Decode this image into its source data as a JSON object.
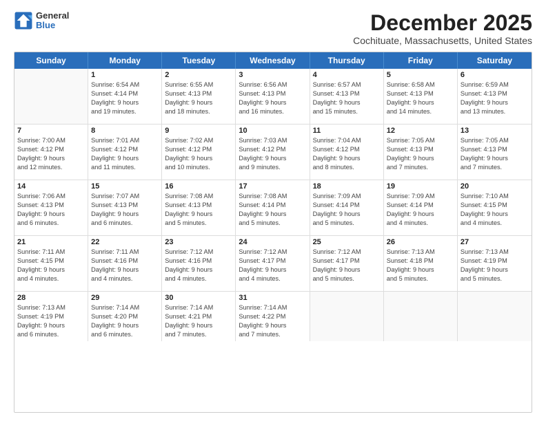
{
  "logo": {
    "general": "General",
    "blue": "Blue"
  },
  "title": "December 2025",
  "subtitle": "Cochituate, Massachusetts, United States",
  "header_days": [
    "Sunday",
    "Monday",
    "Tuesday",
    "Wednesday",
    "Thursday",
    "Friday",
    "Saturday"
  ],
  "weeks": [
    [
      {
        "day": "",
        "lines": []
      },
      {
        "day": "1",
        "lines": [
          "Sunrise: 6:54 AM",
          "Sunset: 4:14 PM",
          "Daylight: 9 hours",
          "and 19 minutes."
        ]
      },
      {
        "day": "2",
        "lines": [
          "Sunrise: 6:55 AM",
          "Sunset: 4:13 PM",
          "Daylight: 9 hours",
          "and 18 minutes."
        ]
      },
      {
        "day": "3",
        "lines": [
          "Sunrise: 6:56 AM",
          "Sunset: 4:13 PM",
          "Daylight: 9 hours",
          "and 16 minutes."
        ]
      },
      {
        "day": "4",
        "lines": [
          "Sunrise: 6:57 AM",
          "Sunset: 4:13 PM",
          "Daylight: 9 hours",
          "and 15 minutes."
        ]
      },
      {
        "day": "5",
        "lines": [
          "Sunrise: 6:58 AM",
          "Sunset: 4:13 PM",
          "Daylight: 9 hours",
          "and 14 minutes."
        ]
      },
      {
        "day": "6",
        "lines": [
          "Sunrise: 6:59 AM",
          "Sunset: 4:13 PM",
          "Daylight: 9 hours",
          "and 13 minutes."
        ]
      }
    ],
    [
      {
        "day": "7",
        "lines": [
          "Sunrise: 7:00 AM",
          "Sunset: 4:12 PM",
          "Daylight: 9 hours",
          "and 12 minutes."
        ]
      },
      {
        "day": "8",
        "lines": [
          "Sunrise: 7:01 AM",
          "Sunset: 4:12 PM",
          "Daylight: 9 hours",
          "and 11 minutes."
        ]
      },
      {
        "day": "9",
        "lines": [
          "Sunrise: 7:02 AM",
          "Sunset: 4:12 PM",
          "Daylight: 9 hours",
          "and 10 minutes."
        ]
      },
      {
        "day": "10",
        "lines": [
          "Sunrise: 7:03 AM",
          "Sunset: 4:12 PM",
          "Daylight: 9 hours",
          "and 9 minutes."
        ]
      },
      {
        "day": "11",
        "lines": [
          "Sunrise: 7:04 AM",
          "Sunset: 4:12 PM",
          "Daylight: 9 hours",
          "and 8 minutes."
        ]
      },
      {
        "day": "12",
        "lines": [
          "Sunrise: 7:05 AM",
          "Sunset: 4:13 PM",
          "Daylight: 9 hours",
          "and 7 minutes."
        ]
      },
      {
        "day": "13",
        "lines": [
          "Sunrise: 7:05 AM",
          "Sunset: 4:13 PM",
          "Daylight: 9 hours",
          "and 7 minutes."
        ]
      }
    ],
    [
      {
        "day": "14",
        "lines": [
          "Sunrise: 7:06 AM",
          "Sunset: 4:13 PM",
          "Daylight: 9 hours",
          "and 6 minutes."
        ]
      },
      {
        "day": "15",
        "lines": [
          "Sunrise: 7:07 AM",
          "Sunset: 4:13 PM",
          "Daylight: 9 hours",
          "and 6 minutes."
        ]
      },
      {
        "day": "16",
        "lines": [
          "Sunrise: 7:08 AM",
          "Sunset: 4:13 PM",
          "Daylight: 9 hours",
          "and 5 minutes."
        ]
      },
      {
        "day": "17",
        "lines": [
          "Sunrise: 7:08 AM",
          "Sunset: 4:14 PM",
          "Daylight: 9 hours",
          "and 5 minutes."
        ]
      },
      {
        "day": "18",
        "lines": [
          "Sunrise: 7:09 AM",
          "Sunset: 4:14 PM",
          "Daylight: 9 hours",
          "and 5 minutes."
        ]
      },
      {
        "day": "19",
        "lines": [
          "Sunrise: 7:09 AM",
          "Sunset: 4:14 PM",
          "Daylight: 9 hours",
          "and 4 minutes."
        ]
      },
      {
        "day": "20",
        "lines": [
          "Sunrise: 7:10 AM",
          "Sunset: 4:15 PM",
          "Daylight: 9 hours",
          "and 4 minutes."
        ]
      }
    ],
    [
      {
        "day": "21",
        "lines": [
          "Sunrise: 7:11 AM",
          "Sunset: 4:15 PM",
          "Daylight: 9 hours",
          "and 4 minutes."
        ]
      },
      {
        "day": "22",
        "lines": [
          "Sunrise: 7:11 AM",
          "Sunset: 4:16 PM",
          "Daylight: 9 hours",
          "and 4 minutes."
        ]
      },
      {
        "day": "23",
        "lines": [
          "Sunrise: 7:12 AM",
          "Sunset: 4:16 PM",
          "Daylight: 9 hours",
          "and 4 minutes."
        ]
      },
      {
        "day": "24",
        "lines": [
          "Sunrise: 7:12 AM",
          "Sunset: 4:17 PM",
          "Daylight: 9 hours",
          "and 4 minutes."
        ]
      },
      {
        "day": "25",
        "lines": [
          "Sunrise: 7:12 AM",
          "Sunset: 4:17 PM",
          "Daylight: 9 hours",
          "and 5 minutes."
        ]
      },
      {
        "day": "26",
        "lines": [
          "Sunrise: 7:13 AM",
          "Sunset: 4:18 PM",
          "Daylight: 9 hours",
          "and 5 minutes."
        ]
      },
      {
        "day": "27",
        "lines": [
          "Sunrise: 7:13 AM",
          "Sunset: 4:19 PM",
          "Daylight: 9 hours",
          "and 5 minutes."
        ]
      }
    ],
    [
      {
        "day": "28",
        "lines": [
          "Sunrise: 7:13 AM",
          "Sunset: 4:19 PM",
          "Daylight: 9 hours",
          "and 6 minutes."
        ]
      },
      {
        "day": "29",
        "lines": [
          "Sunrise: 7:14 AM",
          "Sunset: 4:20 PM",
          "Daylight: 9 hours",
          "and 6 minutes."
        ]
      },
      {
        "day": "30",
        "lines": [
          "Sunrise: 7:14 AM",
          "Sunset: 4:21 PM",
          "Daylight: 9 hours",
          "and 7 minutes."
        ]
      },
      {
        "day": "31",
        "lines": [
          "Sunrise: 7:14 AM",
          "Sunset: 4:22 PM",
          "Daylight: 9 hours",
          "and 7 minutes."
        ]
      },
      {
        "day": "",
        "lines": []
      },
      {
        "day": "",
        "lines": []
      },
      {
        "day": "",
        "lines": []
      }
    ]
  ]
}
